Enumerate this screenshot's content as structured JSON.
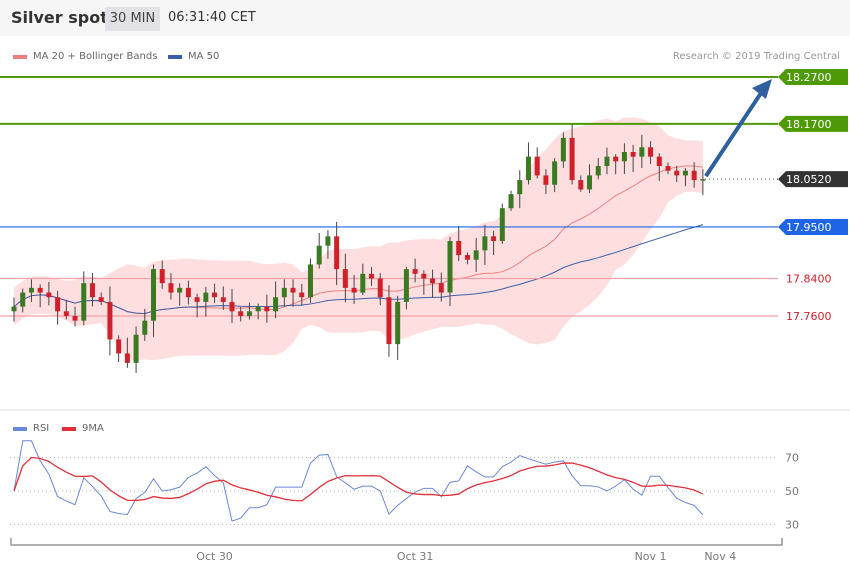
{
  "header": {
    "title": "Silver spot",
    "interval": "30 MIN",
    "time": "06:31:40 CET"
  },
  "legend": {
    "ma20": "MA 20 + Bollinger Bands",
    "ma50": "MA 50",
    "rsi": "RSI",
    "rsi_ma": "9MA"
  },
  "credit": "Research © 2019 Trading Central",
  "colors": {
    "up": "#3a7a22",
    "down": "#d0202a",
    "band": "#ffd6d8",
    "ma20": "#f08080",
    "ma50": "#3a5fa8",
    "target": "#4e9a06",
    "pivot": "#1e64e6",
    "support": "#f0a0a8",
    "current": "#333333",
    "rsi": "#6a88d8",
    "rsi_ma": "#e0303a"
  },
  "chart_data": {
    "type": "candlestick",
    "title": "Silver spot 30 MIN",
    "price_ylim": [
      17.55,
      18.32
    ],
    "closes": [
      17.78,
      17.81,
      17.82,
      17.81,
      17.8,
      17.77,
      17.76,
      17.75,
      17.83,
      17.8,
      17.79,
      17.71,
      17.68,
      17.66,
      17.72,
      17.75,
      17.86,
      17.83,
      17.81,
      17.82,
      17.8,
      17.79,
      17.81,
      17.8,
      17.79,
      17.77,
      17.76,
      17.77,
      17.78,
      17.77,
      17.8,
      17.82,
      17.81,
      17.8,
      17.87,
      17.91,
      17.93,
      17.86,
      17.82,
      17.81,
      17.85,
      17.84,
      17.8,
      17.7,
      17.79,
      17.86,
      17.85,
      17.84,
      17.83,
      17.81,
      17.92,
      17.89,
      17.88,
      17.9,
      17.93,
      17.92,
      17.99,
      18.02,
      18.05,
      18.1,
      18.06,
      18.04,
      18.09,
      18.14,
      18.05,
      18.03,
      18.06,
      18.08,
      18.1,
      18.09,
      18.11,
      18.1,
      18.12,
      18.1,
      18.08,
      18.07,
      18.06,
      18.07,
      18.05,
      18.052
    ],
    "levels": [
      {
        "label": "18.2700",
        "value": 18.27,
        "kind": "target"
      },
      {
        "label": "18.1700",
        "value": 18.17,
        "kind": "target"
      },
      {
        "label": "18.0520",
        "value": 18.052,
        "kind": "current"
      },
      {
        "label": "17.9500",
        "value": 17.95,
        "kind": "pivot"
      },
      {
        "label": "17.8400",
        "value": 17.84,
        "kind": "support"
      },
      {
        "label": "17.7600",
        "value": 17.76,
        "kind": "support"
      }
    ],
    "rsi_ticks": [
      "70",
      "50",
      "30"
    ],
    "rsi_ylim": [
      20,
      82
    ],
    "x_ticks": [
      {
        "label": "Oct 30",
        "index": 23
      },
      {
        "label": "Oct 31",
        "index": 46
      },
      {
        "label": "Nov 1",
        "index": 73
      },
      {
        "label": "Nov 4",
        "index": 81
      }
    ]
  }
}
